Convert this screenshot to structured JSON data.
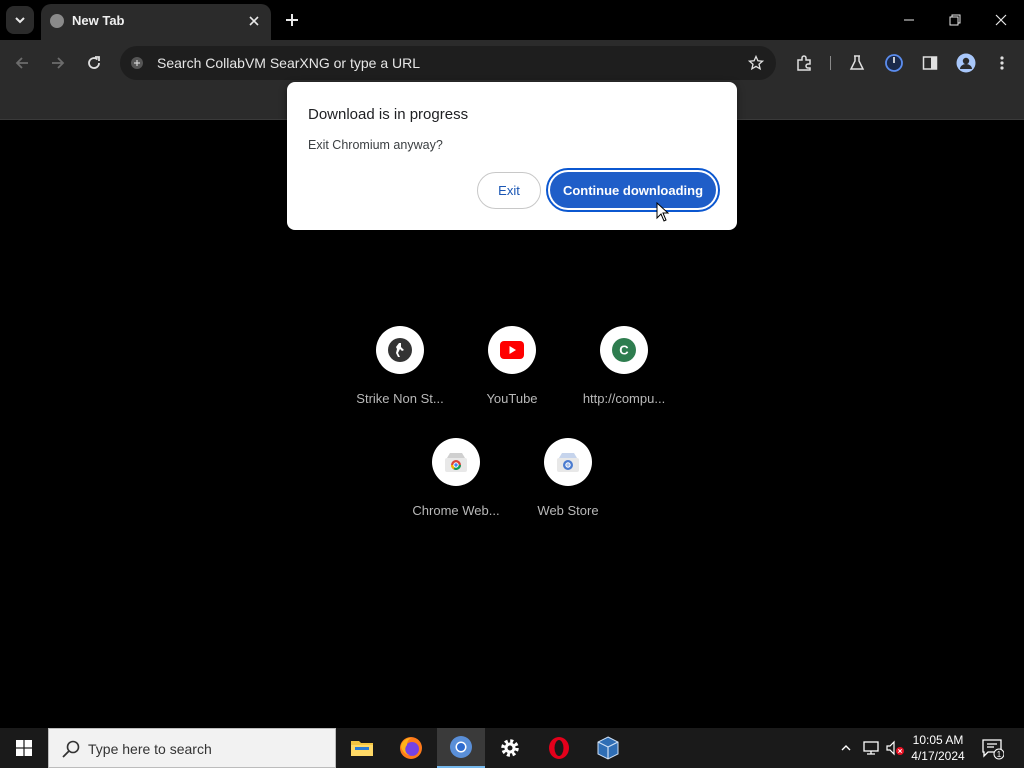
{
  "browser": {
    "tab_title": "New Tab",
    "omnibox_placeholder": "Search CollabVM SearXNG or type a URL"
  },
  "dialog": {
    "title": "Download is in progress",
    "message": "Exit Chromium anyway?",
    "exit_label": "Exit",
    "continue_label": "Continue downloading"
  },
  "shortcuts": [
    {
      "label": "Strike Non St...",
      "icon": "strike-icon"
    },
    {
      "label": "YouTube",
      "icon": "youtube-icon"
    },
    {
      "label": "http://compu...",
      "icon": "letter-c-icon",
      "letter": "C"
    },
    {
      "label": "Chrome Web...",
      "icon": "chrome-web-store-icon"
    },
    {
      "label": "Web Store",
      "icon": "web-store-icon"
    }
  ],
  "taskbar": {
    "search_placeholder": "Type here to search",
    "time": "10:05 AM",
    "date": "4/17/2024",
    "notification_count": "1"
  },
  "colors": {
    "accent": "#1f5ec8",
    "youtube_red": "#ff0000",
    "shortcut_green": "#2e7d4f"
  }
}
